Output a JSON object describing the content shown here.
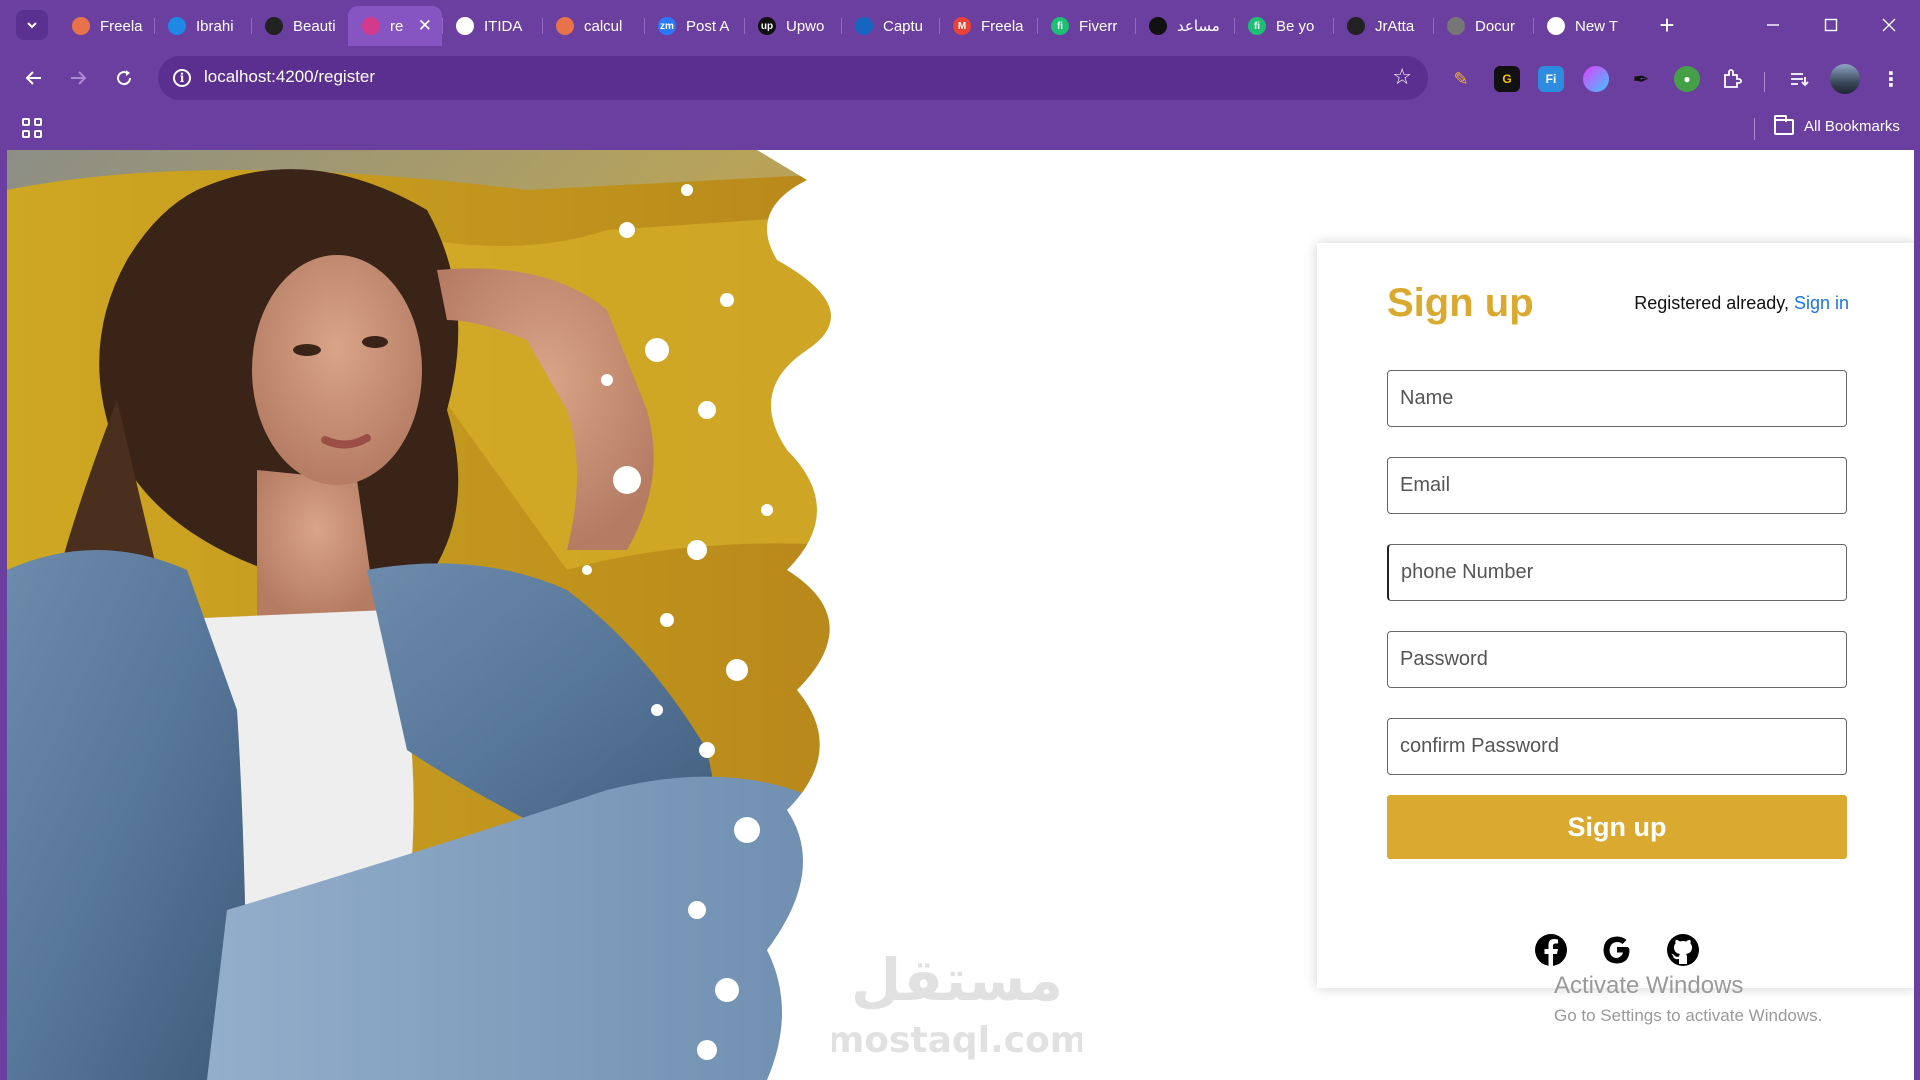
{
  "browser": {
    "tabs": [
      {
        "title": "Freela",
        "icon": "freelancer-icon",
        "color": "#e8734a"
      },
      {
        "title": "Ibrahi",
        "icon": "circle-app-icon",
        "color": "#1e88e5"
      },
      {
        "title": "Beauti",
        "icon": "figma-icon",
        "color": "#222222"
      },
      {
        "title": "re",
        "icon": "angular-icon",
        "color": "#d43a8c",
        "active": true
      },
      {
        "title": "ITIDA",
        "icon": "itida-icon",
        "color": "#ffffff"
      },
      {
        "title": "calcul",
        "icon": "freelancer-icon",
        "color": "#e8734a"
      },
      {
        "title": "Post A",
        "icon": "zm-icon",
        "color": "#2979ff",
        "glyph": "zm"
      },
      {
        "title": "Upwo",
        "icon": "upwork-icon",
        "color": "#111111",
        "glyph": "up"
      },
      {
        "title": "Captu",
        "icon": "trello-icon",
        "color": "#1565c0"
      },
      {
        "title": "Freela",
        "icon": "gmail-icon",
        "color": "#ea4335",
        "glyph": "M"
      },
      {
        "title": "Fiverr",
        "icon": "fiverr-icon",
        "color": "#1dbf73",
        "glyph": "fi"
      },
      {
        "title": "مساعد",
        "icon": "chatgpt-icon",
        "color": "#111111"
      },
      {
        "title": "Be yo",
        "icon": "fiverr-icon",
        "color": "#1dbf73",
        "glyph": "fi"
      },
      {
        "title": "JrAtta",
        "icon": "github-icon",
        "color": "#222222"
      },
      {
        "title": "Docur",
        "icon": "document-icon",
        "color": "#777777"
      },
      {
        "title": "New T",
        "icon": "chrome-icon",
        "color": "#ffffff"
      }
    ],
    "url": "localhost:4200/register",
    "bookmarks_all": "All Bookmarks"
  },
  "form": {
    "title": "Sign up",
    "registered_text": "Registered already, ",
    "signin_link": "Sign in",
    "name_placeholder": "Name",
    "email_placeholder": "Email",
    "phone_placeholder": "phone Number",
    "password_placeholder": "Password",
    "confirm_placeholder": "confirm Password",
    "submit_label": "Sign up",
    "social": [
      "facebook-icon",
      "google-icon",
      "github-icon"
    ]
  },
  "os_overlay": {
    "activate_title": "Activate Windows",
    "activate_sub": "Go to Settings to activate Windows."
  },
  "watermark": {
    "arabic": "مستقل",
    "latin": "mostaql.com"
  },
  "colors": {
    "browser_frame": "#6b3fa0",
    "accent_gold": "#d9a930",
    "link_blue": "#1a73e8"
  }
}
